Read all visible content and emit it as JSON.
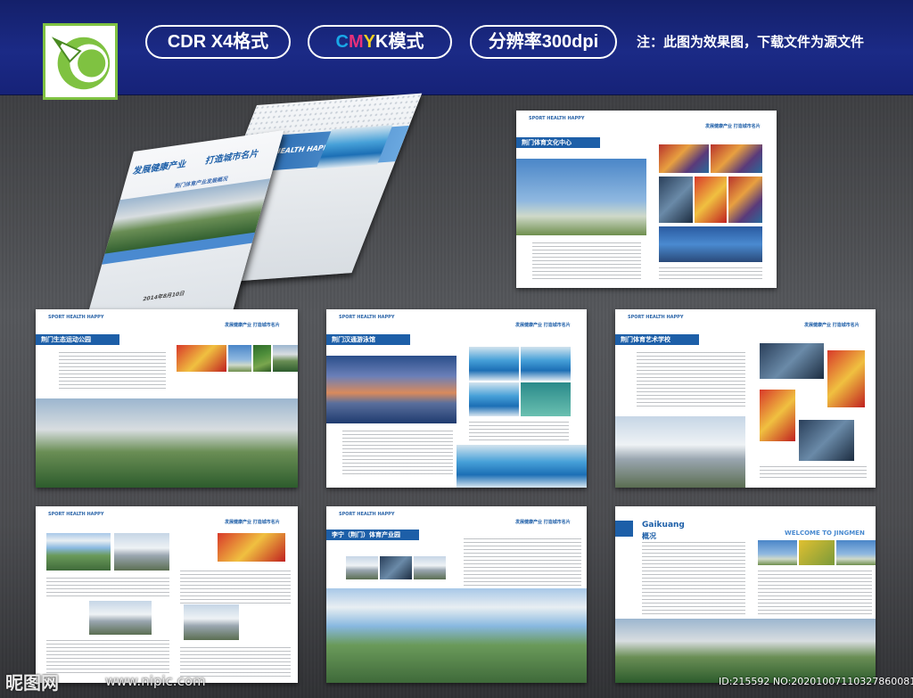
{
  "header": {
    "badges": [
      "CDR X4格式",
      "CMYK模式",
      "分辨率300dpi"
    ],
    "cmyk": {
      "c": "C",
      "m": "M",
      "y": "Y",
      "k": "K",
      "rest": "模式"
    },
    "note": "注：此图为效果图，下载文件为源文件"
  },
  "covers": {
    "front_title_1": "发展健康产业",
    "front_title_2": "打造城市名片",
    "front_subtitle": "荆门体育产业发展概况",
    "front_date": "2014年8月10日",
    "back_brand": "SPORT HEALTH HAPPY"
  },
  "spreads": [
    {
      "brand": "SPORT HEALTH HAPPY",
      "slogan": "发展健康产业   打造城市名片",
      "section": "荆门体育文化中心"
    },
    {
      "brand": "SPORT HEALTH HAPPY",
      "slogan": "发展健康产业   打造城市名片",
      "section": "荆门生态运动公园"
    },
    {
      "brand": "SPORT HEALTH HAPPY",
      "slogan": "发展健康产业   打造城市名片",
      "section": "荆门汉通游泳馆"
    },
    {
      "brand": "SPORT HEALTH HAPPY",
      "slogan": "发展健康产业   打造城市名片",
      "section": "荆门体育艺术学校"
    },
    {
      "brand": "SPORT HEALTH HAPPY",
      "slogan": "发展健康产业   打造城市名片",
      "section": ""
    },
    {
      "brand": "SPORT HEALTH HAPPY",
      "slogan": "发展健康产业   打造城市名片",
      "section": "李宁（荆门）体育产业园"
    },
    {
      "section_en": "Gaikuang",
      "section": "概况",
      "welcome": "WELCOME TO JINGMEN"
    }
  ],
  "watermark": {
    "site": "昵图网",
    "url": "www.nipic.com",
    "id": "ID:215592 NO:20201007110327860081"
  },
  "colors": {
    "header_bg": "#1b2a86",
    "accent": "#1d5fa8",
    "logo_green": "#7fc241"
  }
}
